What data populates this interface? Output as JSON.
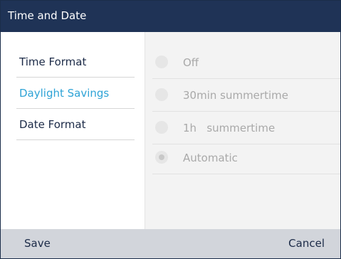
{
  "window": {
    "title": "Time and Date"
  },
  "sidebar": {
    "items": [
      {
        "label": "Time Format",
        "active": false
      },
      {
        "label": "Daylight Savings",
        "active": true
      },
      {
        "label": "Date Format",
        "active": false
      }
    ]
  },
  "options": {
    "items": [
      {
        "label": "Off",
        "selected": false
      },
      {
        "label": "30min summertime",
        "selected": false
      },
      {
        "label": "1h   summertime",
        "selected": false
      },
      {
        "label": "Automatic",
        "selected": true
      }
    ]
  },
  "softkeys": {
    "left_label": "Save",
    "right_label": "Cancel"
  },
  "colors": {
    "titlebar": "#1f3356",
    "active_item": "#2ea3d6",
    "footer": "#d2d5db",
    "options_panel": "#f3f3f3"
  }
}
